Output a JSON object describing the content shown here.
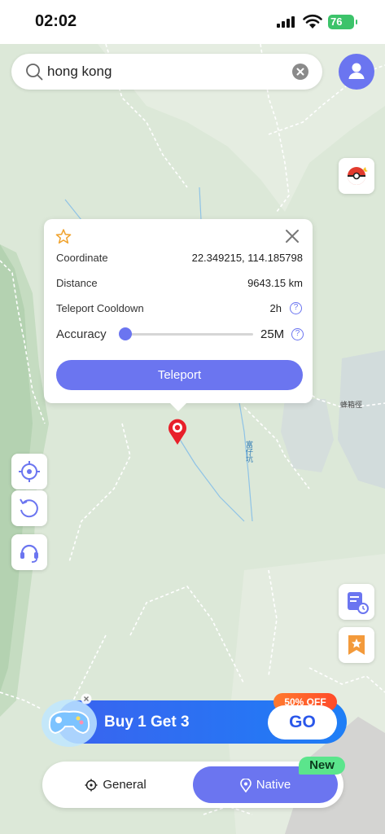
{
  "status_bar": {
    "time": "02:02",
    "battery": "76"
  },
  "search": {
    "value": "hong kong"
  },
  "map": {
    "labels": [
      "蜂箱徑",
      "富仔坑"
    ],
    "marker_color": "#e8202a"
  },
  "popup": {
    "coordinate_label": "Coordinate",
    "coordinate_value": "22.349215, 114.185798",
    "distance_label": "Distance",
    "distance_value": "9643.15 km",
    "cooldown_label": "Teleport Cooldown",
    "cooldown_value": "2h",
    "accuracy_label": "Accuracy",
    "accuracy_value": "25M",
    "accuracy_level": 0.0,
    "teleport_label": "Teleport",
    "help_glyph": "?"
  },
  "promo": {
    "text": "Buy 1 Get 3",
    "go_label": "GO",
    "badge": "50% OFF"
  },
  "mode_switch": {
    "general_label": "General",
    "native_label": "Native",
    "new_badge": "New"
  },
  "colors": {
    "accent": "#6b75f0",
    "map_bg": "#dce8d8",
    "promo": "#2a60ef",
    "new_badge": "#5be58c"
  }
}
